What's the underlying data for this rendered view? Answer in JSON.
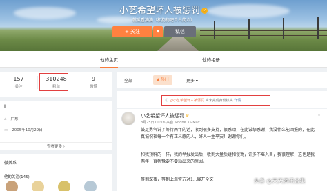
{
  "profile": {
    "name": "小艺希望坏人被惩罚",
    "subtitle": "就爱看猫猫（和狗狗吧个人简介）",
    "follow_label": "+ 关注",
    "caret": "▼",
    "message_label": "私信"
  },
  "nav": {
    "tabs": [
      "他的主页",
      "他的相册"
    ]
  },
  "stats": [
    {
      "value": "157",
      "label": "关注"
    },
    {
      "value": "310248",
      "label": "粉丝"
    },
    {
      "value": "9",
      "label": "微博"
    }
  ],
  "info": {
    "heading": "Ⅱ",
    "location": "广东",
    "birthday": "2005年10月29日",
    "more_label": "查看更多 ›"
  },
  "relations": {
    "heading": "微关系",
    "sub_label": "他的关注(145)"
  },
  "filter": {
    "all": "全部",
    "hot": "热门",
    "more": "更多 ▾"
  },
  "notice": {
    "icon": "info-icon",
    "user": "@小艺希望坏人被惩罚",
    "text": " 尚未完成身份核实 ",
    "detail": "详情"
  },
  "post": {
    "author": "小艺希望坏人被惩罚",
    "meta": "8月25日 00:16 来自 iPhone XS Max",
    "paragraph1": "鼓足勇气说了等待两年的话，收到很多支持，很感动，在此诚挚感谢，我没什么能回报的，在此真诚祝福每一个有正义感的人，好人一生平安！谢谢你们。",
    "paragraph2": "和我预料的一样，我的举报发出后，收到大量质疑和谩骂，许多不堪入目，我很理解，这也是我两年一直犹豫要不要站出来的原因。",
    "paragraph3": "等到深夜，等到上海警方对1...展开全文",
    "expand": "展开全文 ▾"
  },
  "watermark": "头条 @天天资讯合集",
  "colors": {
    "accent": "#fa7d3c",
    "highlight_border": "#e24040",
    "link": "#eb7350",
    "verify": "#f8b21a"
  }
}
